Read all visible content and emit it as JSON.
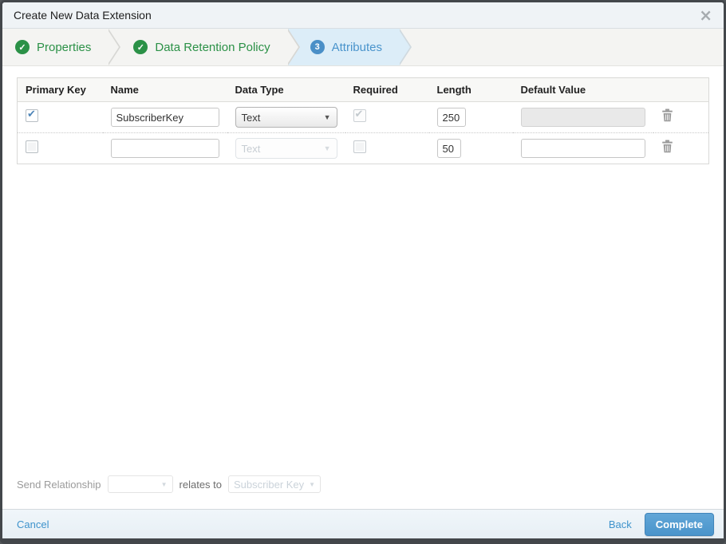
{
  "dialog": {
    "title": "Create New Data Extension"
  },
  "icons": {
    "close": "×",
    "check": "✓",
    "caret": "▼"
  },
  "steps": [
    {
      "label": "Properties",
      "status": "complete"
    },
    {
      "label": "Data Retention Policy",
      "status": "complete"
    },
    {
      "label": "Attributes",
      "status": "active",
      "number": "3"
    }
  ],
  "table": {
    "headers": {
      "primary_key": "Primary Key",
      "name": "Name",
      "data_type": "Data Type",
      "required": "Required",
      "length": "Length",
      "default_value": "Default Value"
    },
    "rows": [
      {
        "primary_key_checked": true,
        "name": "SubscriberKey",
        "data_type": "Text",
        "data_type_disabled": false,
        "required_checked": true,
        "required_disabled": true,
        "length": "250",
        "default_value": "",
        "default_disabled": true
      },
      {
        "primary_key_checked": false,
        "name": "",
        "data_type": "Text",
        "data_type_disabled": true,
        "required_checked": false,
        "required_disabled": true,
        "length": "50",
        "default_value": "",
        "default_disabled": false
      }
    ]
  },
  "send_relationship": {
    "label": "Send Relationship",
    "relates_to": "relates to",
    "target_field": "Subscriber Key"
  },
  "footer": {
    "cancel": "Cancel",
    "back": "Back",
    "complete": "Complete"
  },
  "colors": {
    "step_green": "#2b9147",
    "step_blue": "#4a94cc",
    "active_step_bg": "#dcedf8",
    "complete_button": "#4a94cb",
    "link_blue": "#3e93cc"
  }
}
